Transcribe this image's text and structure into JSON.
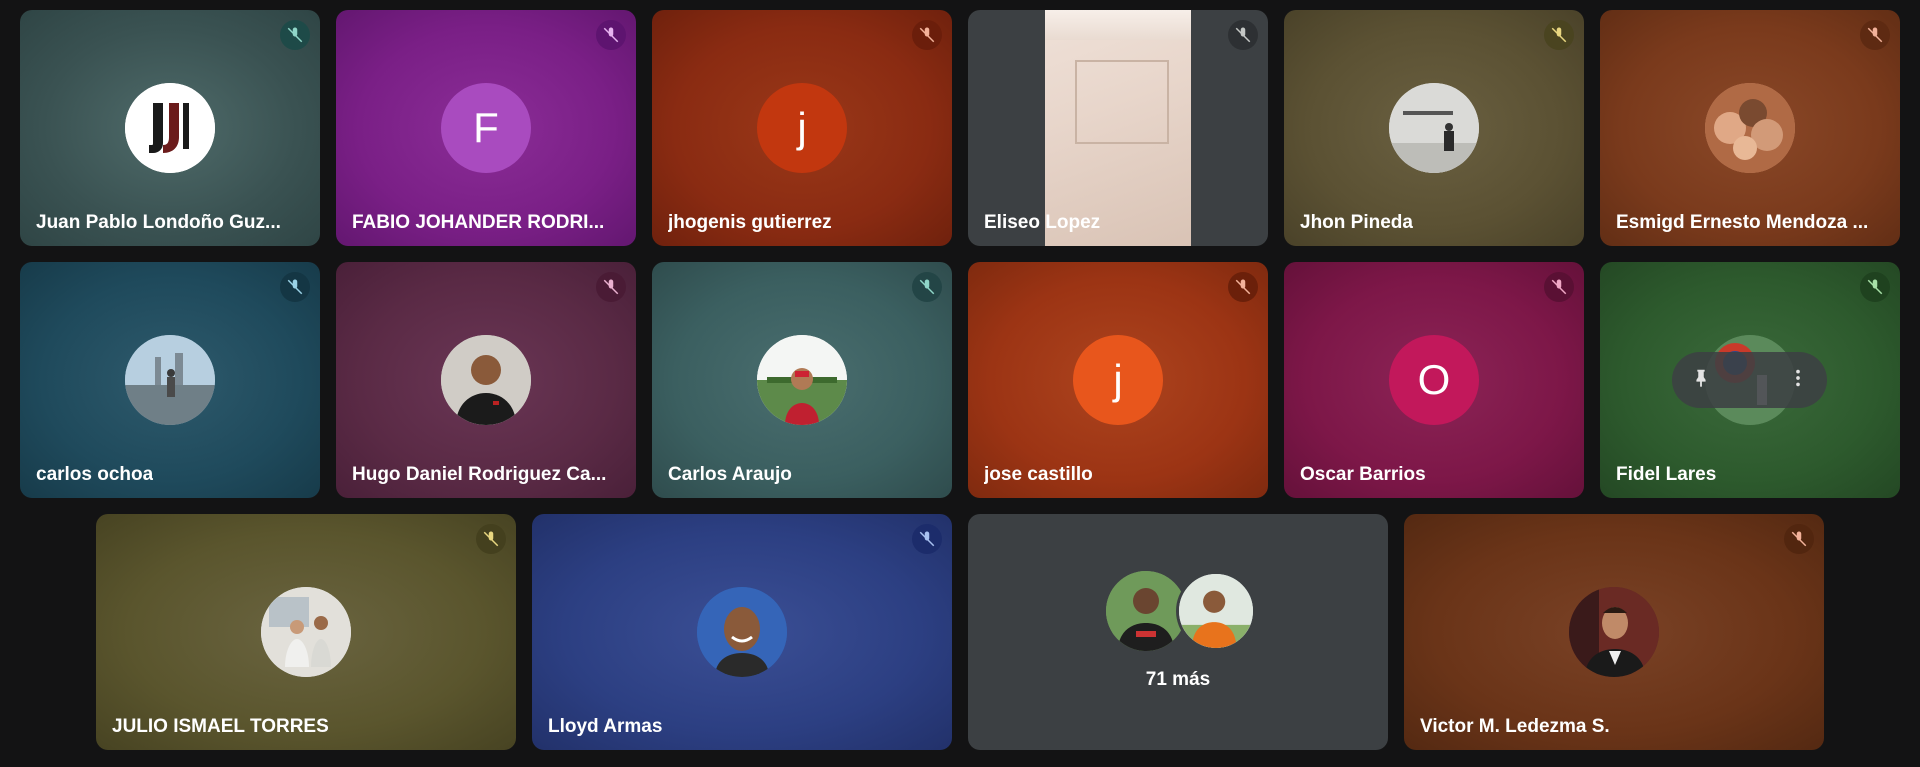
{
  "participants": [
    {
      "name": "Juan Pablo Londoño Guz...",
      "avatar_type": "logo",
      "bg": "#3f5b5b",
      "mute_bg": "#1e4a48"
    },
    {
      "name": "FABIO JOHANDER RODRI...",
      "avatar_type": "letter",
      "letter": "F",
      "bg": "#7a1f86",
      "avatar_color": "#a94bbf",
      "mute_bg": "#5e1470"
    },
    {
      "name": "jhogenis gutierrez",
      "avatar_type": "letter",
      "letter": "j",
      "bg": "#8a2b12",
      "avatar_color": "#c2370f",
      "mute_bg": "#6b1e0b"
    },
    {
      "name": "Eliseo Lopez",
      "avatar_type": "video",
      "bg": "#3c4043",
      "mute_bg": "#2d3033"
    },
    {
      "name": "Jhon Pineda",
      "avatar_type": "photo",
      "bg": "#5b5133",
      "mute_bg": "#4a4420"
    },
    {
      "name": "Esmigd Ernesto Mendoza ...",
      "avatar_type": "photo",
      "bg": "#7a3a1c",
      "mute_bg": "#5e2a12"
    },
    {
      "name": "carlos ochoa",
      "avatar_type": "photo",
      "bg": "#1f4a5c",
      "mute_bg": "#143644"
    },
    {
      "name": "Hugo Daniel Rodriguez Ca...",
      "avatar_type": "photo",
      "bg": "#5a2a45",
      "mute_bg": "#4a1b35"
    },
    {
      "name": "Carlos Araujo",
      "avatar_type": "photo",
      "bg": "#3b5f60",
      "mute_bg": "#234546"
    },
    {
      "name": "jose castillo",
      "avatar_type": "letter",
      "letter": "j",
      "bg": "#9c3414",
      "avatar_color": "#e8561c",
      "mute_bg": "#6b200a"
    },
    {
      "name": "Oscar Barrios",
      "avatar_type": "letter",
      "letter": "O",
      "bg": "#7d1748",
      "avatar_color": "#c2185b",
      "mute_bg": "#5a1034"
    },
    {
      "name": "Fidel Lares",
      "avatar_type": "photo",
      "bg": "#2d5a2d",
      "mute_bg": "#1f421f",
      "hover_controls": [
        "pin-icon",
        "more-vert-icon"
      ]
    },
    {
      "name": "JULIO ISMAEL TORRES",
      "avatar_type": "photo",
      "bg": "#5a552d",
      "mute_bg": "#44401e"
    },
    {
      "name": "Lloyd Armas",
      "avatar_type": "photo",
      "bg": "#2c3f82",
      "mute_bg": "#1c2c6b"
    },
    {
      "name": "Victor M. Ledezma S.",
      "avatar_type": "photo",
      "bg": "#6a3418",
      "mute_bg": "#52260f"
    }
  ],
  "overflow_tile": {
    "label": "71 más"
  },
  "icons": {
    "mute": "mic-off-icon",
    "pin": "pin-icon",
    "more": "more-vert-icon"
  }
}
